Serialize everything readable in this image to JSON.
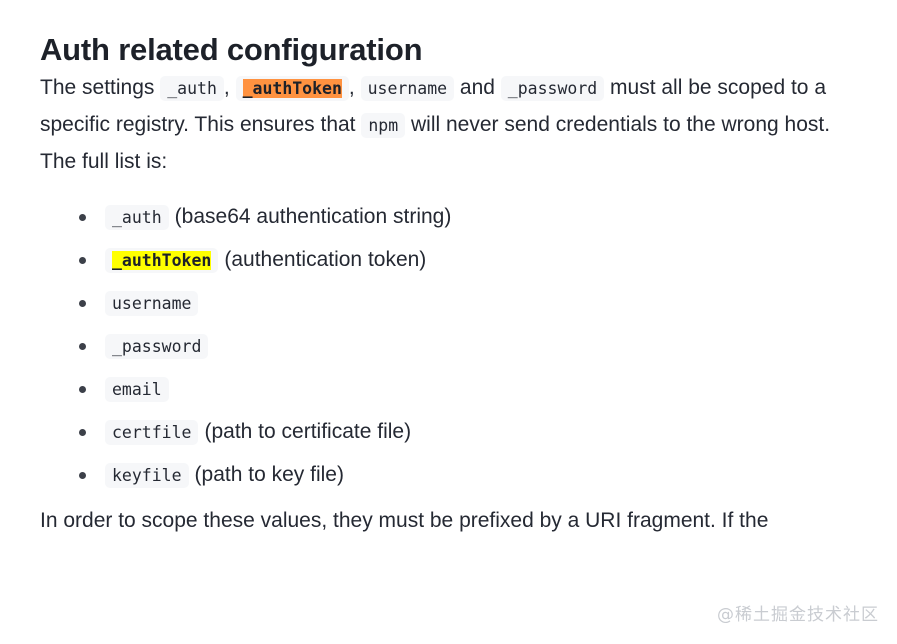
{
  "page": {
    "title": "Auth related configuration",
    "background_color": "#ffffff",
    "text_color": "#252933"
  },
  "colors": {
    "code_chip_background": "#f6f7f9",
    "highlight_orange": "#ff9240",
    "highlight_yellow": "#ffff00",
    "bullet": "#3c4049",
    "watermark": "#c9ccd1"
  },
  "intro_paragraph": {
    "segment_1": "The settings ",
    "code_auth": "_auth",
    "separator_1": ", ",
    "code_auth_token": "_authToken",
    "separator_2": ", ",
    "code_username": "username",
    "segment_2": " and ",
    "code_password": "_password",
    "segment_3": " must all be scoped to a specific registry. This ensures that ",
    "code_npm": "npm",
    "segment_4": " will never send credentials to the wrong host."
  },
  "full_list_lead": "The full list is:",
  "list": [
    {
      "code": "_auth",
      "highlight": "none",
      "desc": "(base64 authentication string)"
    },
    {
      "code": "_authToken",
      "highlight": "yellow",
      "desc": "(authentication token)"
    },
    {
      "code": "username",
      "highlight": "none",
      "desc": ""
    },
    {
      "code": "_password",
      "highlight": "none",
      "desc": ""
    },
    {
      "code": "email",
      "highlight": "none",
      "desc": ""
    },
    {
      "code": "certfile",
      "highlight": "none",
      "desc": "(path to certificate file)"
    },
    {
      "code": "keyfile",
      "highlight": "none",
      "desc": "(path to key file)"
    }
  ],
  "tail_paragraph": "In order to scope these values, they must be prefixed by a URI fragment. If the",
  "watermark": "@稀土掘金技术社区"
}
